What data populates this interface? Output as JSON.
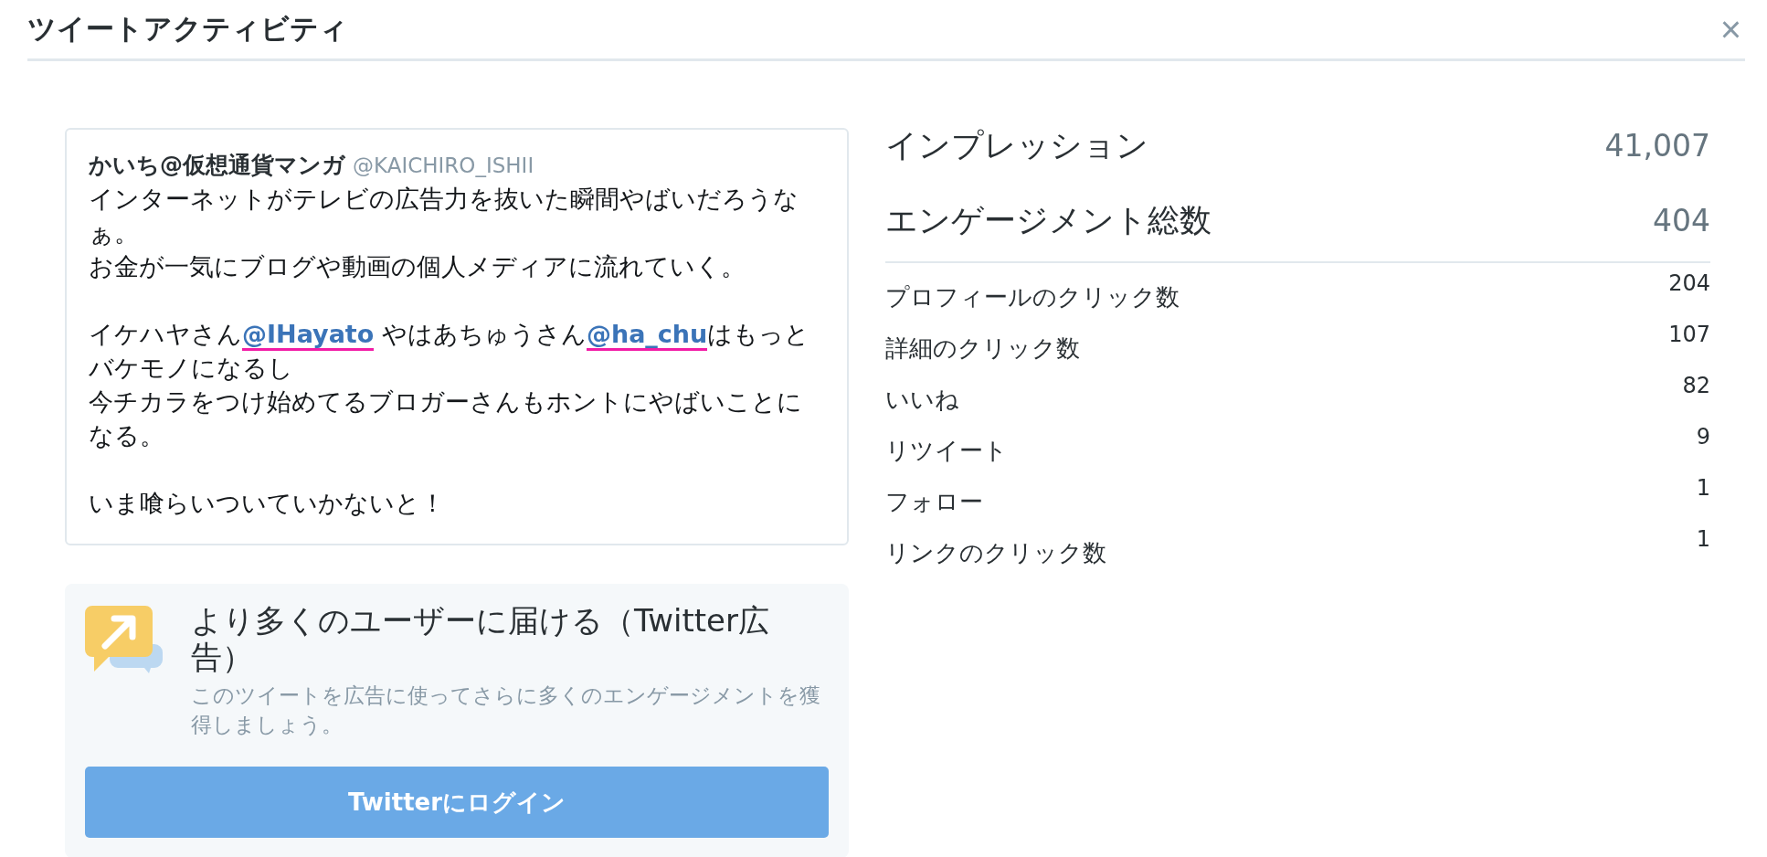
{
  "dialog": {
    "title": "ツイートアクティビティ",
    "close": "×"
  },
  "tweet": {
    "author": "かいち@仮想通貨マンガ",
    "handle": "@KAICHIRO_ISHII",
    "paragraphs": [
      [
        [
          {
            "kind": "text",
            "text": "インターネットがテレビの広告力を抜いた瞬間やばいだろうなぁ。"
          }
        ],
        [
          {
            "kind": "text",
            "text": "お金が一気にブログや動画の個人メディアに流れていく。"
          }
        ]
      ],
      [
        [
          {
            "kind": "text",
            "text": "イケハヤさん"
          },
          {
            "kind": "mention",
            "text": "@IHayato",
            "marked": true
          },
          {
            "kind": "text",
            "text": " やはあちゅうさん"
          },
          {
            "kind": "mention",
            "text": "@ha_chu",
            "marked": true
          },
          {
            "kind": "text",
            "text": "はもっとバケモノになるし"
          }
        ],
        [
          {
            "kind": "text",
            "text": "今チカラをつけ始めてるブロガーさんもホントにやばいことになる。"
          }
        ]
      ],
      [
        [
          {
            "kind": "text",
            "text": "いま喰らいついていかないと！"
          }
        ]
      ]
    ]
  },
  "promo": {
    "title": "より多くのユーザーに届ける（Twitter広告）",
    "description": "このツイートを広告に使ってさらに多くのエンゲージメントを獲得しましょう。",
    "button": "Twitterにログイン"
  },
  "stats": {
    "summary": [
      {
        "label": "インプレッション",
        "value": "41,007"
      },
      {
        "label": "エンゲージメント総数",
        "value": "404"
      }
    ],
    "rows": [
      {
        "label": "プロフィールのクリック数",
        "value": "204"
      },
      {
        "label": "詳細のクリック数",
        "value": "107"
      },
      {
        "label": "いいね",
        "value": "82"
      },
      {
        "label": "リツイート",
        "value": "9"
      },
      {
        "label": "フォロー",
        "value": "1"
      },
      {
        "label": "リンクのクリック数",
        "value": "1"
      }
    ]
  }
}
